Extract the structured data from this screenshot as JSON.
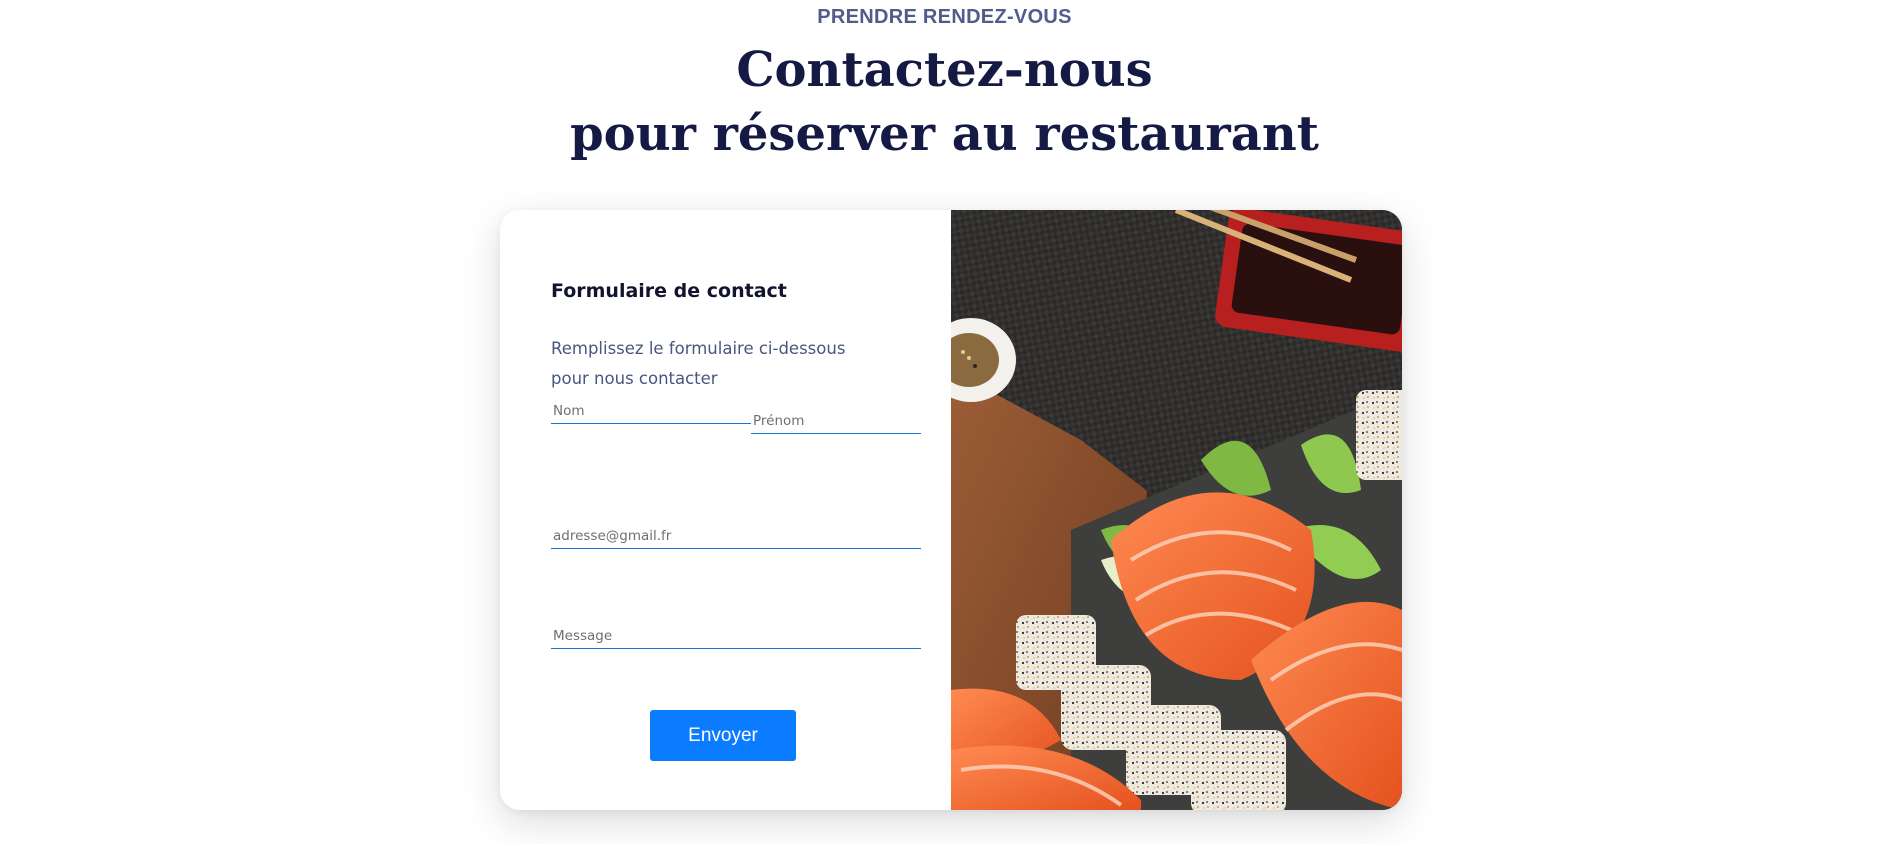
{
  "header": {
    "eyebrow": "PRENDRE RENDEZ-VOUS",
    "title_line1": "Contactez-nous",
    "title_line2": "pour réserver au restaurant"
  },
  "form": {
    "title": "Formulaire de contact",
    "description_line1": "Remplissez le formulaire ci-dessous",
    "description_line2": "pour nous contacter",
    "nom_placeholder": "Nom",
    "prenom_placeholder": "Prénom",
    "email_placeholder": "adresse@gmail.fr",
    "message_placeholder": "Message",
    "submit_label": "Envoyer"
  },
  "colors": {
    "heading": "#141a44",
    "eyebrow": "#4e5d8a",
    "accent": "#0b7bff",
    "field_border": "#1a74d4"
  },
  "image": {
    "subject": "sushi-platter-photo"
  }
}
